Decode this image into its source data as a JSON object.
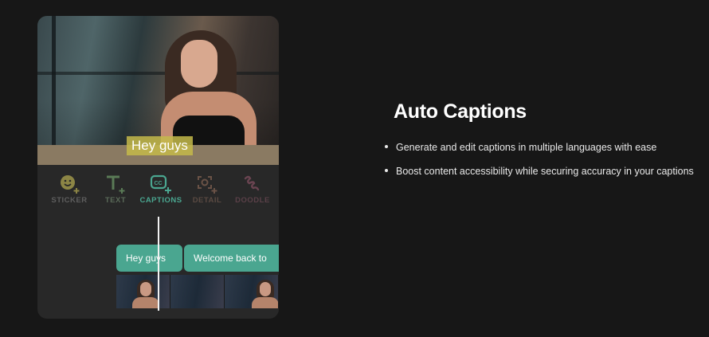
{
  "preview": {
    "caption_overlay": "Hey guys"
  },
  "toolbar": {
    "tools": [
      {
        "label": "STICKER",
        "icon": "sticker-icon",
        "color": "#8c8545"
      },
      {
        "label": "TEXT",
        "icon": "text-icon",
        "color": "#5a7a56"
      },
      {
        "label": "CAPTIONS",
        "icon": "captions-icon",
        "color": "#4aa690"
      },
      {
        "label": "DETAIL",
        "icon": "detail-icon",
        "color": "#6a5246"
      },
      {
        "label": "DOODLE",
        "icon": "doodle-icon",
        "color": "#6a4451"
      }
    ]
  },
  "timeline": {
    "clips": [
      {
        "label": "Hey guys"
      },
      {
        "label": "Welcome back to"
      }
    ],
    "clip_color": "#4aa690"
  },
  "feature": {
    "title": "Auto Captions",
    "bullets": [
      "Generate and edit captions in multiple languages with ease",
      "Boost content accessibility while securing accuracy in your captions"
    ]
  }
}
